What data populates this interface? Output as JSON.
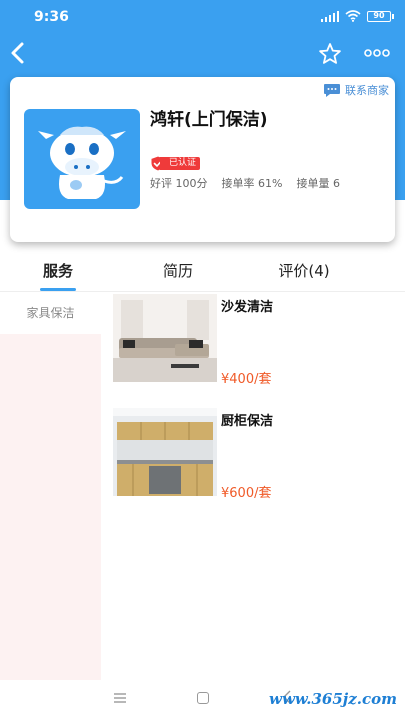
{
  "status_bar": {
    "time": "9:36",
    "battery": "90"
  },
  "nav": {
    "back_icon": "chevron-left-icon",
    "star_icon": "star-outline-icon",
    "more_icon": "more-dots-icon"
  },
  "shop": {
    "contact_label": "联系商家",
    "name": "鸿轩(上门保洁)",
    "certified_label": "已认证",
    "stats": {
      "rating": "好评 100分",
      "accept_rate": "接单率 61%",
      "order_count": "接单量 6"
    }
  },
  "tabs": [
    {
      "label": "服务",
      "active": true
    },
    {
      "label": "简历",
      "active": false
    },
    {
      "label": "评价(4)",
      "active": false
    }
  ],
  "categories": [
    {
      "label": "家具保洁",
      "active": true
    }
  ],
  "services": [
    {
      "title": "沙发清洁",
      "price": "¥400/套",
      "image": "sofa-photo"
    },
    {
      "title": "厨柜保洁",
      "price": "¥600/套",
      "image": "kitchen-cabinet-photo"
    }
  ],
  "watermark": "www.365jz.com",
  "colors": {
    "brand_blue": "#3aa0f0",
    "price_orange": "#f05a28",
    "cert_red": "#ef3a3a",
    "sidebar_bg": "#fdf2f2"
  }
}
